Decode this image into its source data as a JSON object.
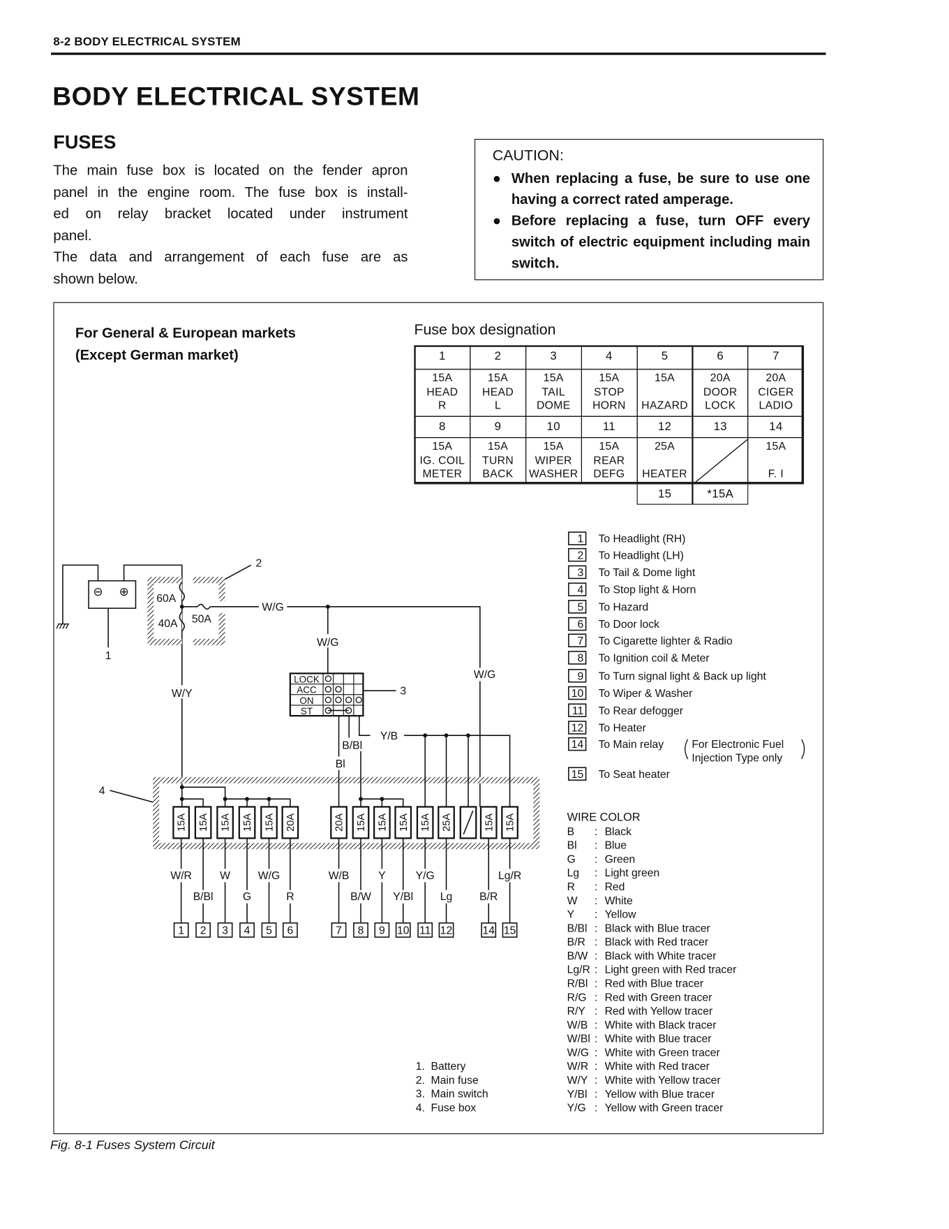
{
  "header": {
    "section": "8-2 BODY ELECTRICAL SYSTEM",
    "title": "BODY ELECTRICAL SYSTEM"
  },
  "fuses": {
    "heading": "FUSES",
    "paragraph": [
      "The main fuse box is located on the fender apron",
      "panel in the engine room. The fuse box is install-",
      "ed on relay bracket located under instrument",
      "panel.",
      "The data and arrangement of each fuse are as",
      "shown below."
    ]
  },
  "caution": {
    "title": "CAUTION:",
    "bullet": "●",
    "items": [
      "When replacing a fuse, be sure to use one having a correct rated amperage.",
      "Before replacing a fuse, turn OFF every switch of electric equipment including main switch."
    ]
  },
  "figure": {
    "market_title": [
      "For General & European markets",
      "(Except German market)"
    ],
    "fuse_table_title": "Fuse box designation",
    "fuse_table": {
      "row1_numbers": [
        "1",
        "2",
        "3",
        "4",
        "5",
        "6",
        "7"
      ],
      "row1_contents": [
        [
          "15A",
          "HEAD",
          "R"
        ],
        [
          "15A",
          "HEAD",
          "L"
        ],
        [
          "15A",
          "TAIL",
          "DOME"
        ],
        [
          "15A",
          "STOP",
          "HORN"
        ],
        [
          "15A",
          "",
          "HAZARD"
        ],
        [
          "20A",
          "DOOR",
          "LOCK"
        ],
        [
          "20A",
          "CIGER",
          "LADIO"
        ]
      ],
      "row2_numbers": [
        "8",
        "9",
        "10",
        "11",
        "12",
        "13",
        "14"
      ],
      "row2_contents": [
        [
          "15A",
          "IG. COIL",
          "METER"
        ],
        [
          "15A",
          "TURN",
          "BACK"
        ],
        [
          "15A",
          "WIPER",
          "WASHER"
        ],
        [
          "15A",
          "REAR",
          "DEFG"
        ],
        [
          "25A",
          "",
          "HEATER"
        ],
        null,
        [
          "15A",
          "",
          "F. I"
        ]
      ],
      "extra_row": [
        "15",
        "*15A"
      ]
    },
    "legend": [
      {
        "num": "1",
        "text": "To Headlight (RH)"
      },
      {
        "num": "2",
        "text": "To Headlight (LH)"
      },
      {
        "num": "3",
        "text": "To Tail & Dome light"
      },
      {
        "num": "4",
        "text": "To Stop light & Horn"
      },
      {
        "num": "5",
        "text": "To Hazard"
      },
      {
        "num": "6",
        "text": "To Door lock"
      },
      {
        "num": "7",
        "text": "To Cigarette lighter & Radio"
      },
      {
        "num": "8",
        "text": "To Ignition coil & Meter"
      },
      {
        "num": "9",
        "text": "To Turn signal light & Back up light"
      },
      {
        "num": "10",
        "text": "To Wiper & Washer"
      },
      {
        "num": "11",
        "text": "To Rear defogger"
      },
      {
        "num": "12",
        "text": "To Heater"
      },
      {
        "num": "14",
        "text": "To Main relay",
        "note": [
          "For Electronic Fuel",
          "Injection Type only"
        ]
      },
      {
        "num": "15",
        "text": "To Seat heater"
      }
    ],
    "wire_color": {
      "title": "WIRE COLOR",
      "entries": [
        [
          "B",
          "Black"
        ],
        [
          "Bl",
          "Blue"
        ],
        [
          "G",
          "Green"
        ],
        [
          "Lg",
          "Light green"
        ],
        [
          "R",
          "Red"
        ],
        [
          "W",
          "White"
        ],
        [
          "Y",
          "Yellow"
        ],
        [
          "B/Bl",
          "Black with Blue tracer"
        ],
        [
          "B/R",
          "Black with Red tracer"
        ],
        [
          "B/W",
          "Black with White tracer"
        ],
        [
          "Lg/R",
          "Light green with Red tracer"
        ],
        [
          "R/Bl",
          "Red with Blue tracer"
        ],
        [
          "R/G",
          "Red with Green tracer"
        ],
        [
          "R/Y",
          "Red with Yellow tracer"
        ],
        [
          "W/B",
          "White with Black tracer"
        ],
        [
          "W/Bl",
          "White with Blue tracer"
        ],
        [
          "W/G",
          "White with Green tracer"
        ],
        [
          "W/R",
          "White with Red tracer"
        ],
        [
          "W/Y",
          "White with Yellow tracer"
        ],
        [
          "Y/Bl",
          "Yellow with Blue tracer"
        ],
        [
          "Y/G",
          "Yellow with Green tracer"
        ]
      ]
    },
    "parts": [
      "1.  Battery",
      "2.  Main fuse",
      "3.  Main switch",
      "4.  Fuse box"
    ],
    "diagram": {
      "callouts": [
        "1",
        "2",
        "3",
        "4"
      ],
      "main_fuses": [
        "60A",
        "40A",
        "50A"
      ],
      "battery_terminals": [
        "⊖",
        "⊕"
      ],
      "switch_positions": [
        "LOCK",
        "ACC",
        "ON",
        "ST"
      ],
      "wire_labels_top": {
        "wg_main": "W/G",
        "wg_switch": "W/G",
        "wg_right": "W/G",
        "wy": "W/Y",
        "bbl": "B/Bl",
        "bl": "Bl",
        "yb": "Y/B"
      },
      "fuse_ratings_left": [
        "15A",
        "15A",
        "15A",
        "15A",
        "15A",
        "20A"
      ],
      "fuse_ratings_right": [
        "20A",
        "15A",
        "15A",
        "15A",
        "15A",
        "25A",
        "",
        "15A",
        "15A"
      ],
      "wire_labels_bottom": [
        "W/R",
        "B/Bl",
        "W",
        "G",
        "W/G",
        "R",
        "W/B",
        "B/W",
        "Y",
        "Y/Bl",
        "Y/G",
        "Lg",
        "",
        "B/R",
        "Lg/R"
      ],
      "connectors": [
        "1",
        "2",
        "3",
        "4",
        "5",
        "6",
        "7",
        "8",
        "9",
        "10",
        "11",
        "12",
        "",
        "14",
        "15"
      ]
    },
    "caption": "Fig. 8-1  Fuses System Circuit"
  }
}
